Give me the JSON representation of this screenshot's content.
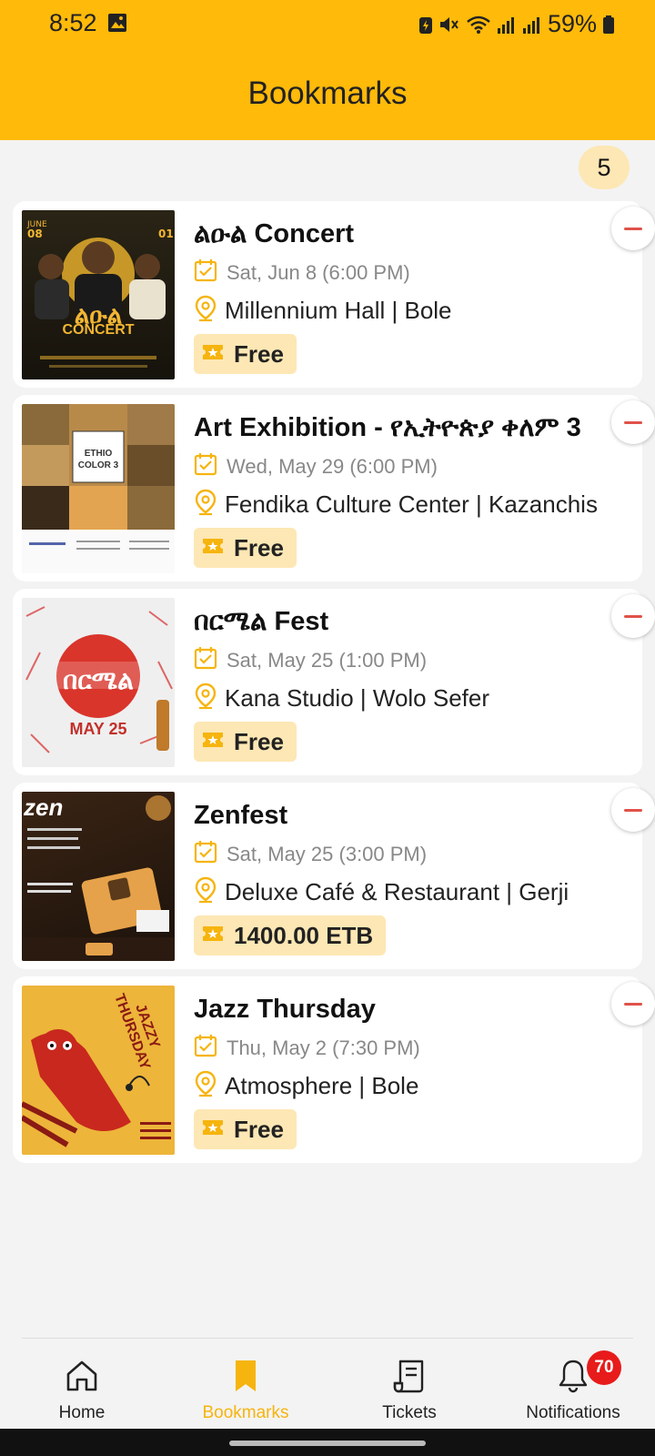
{
  "status_bar": {
    "time": "8:52",
    "battery": "59%",
    "icons": [
      "image-icon",
      "battery-saver-icon",
      "mute-icon",
      "wifi-icon",
      "signal-icon",
      "signal-icon",
      "battery-icon"
    ]
  },
  "header": {
    "title": "Bookmarks"
  },
  "bookmarks_count": "5",
  "events": [
    {
      "title": "ልዑል Concert",
      "date": "Sat, Jun 8 (6:00 PM)",
      "location": "Millennium Hall | Bole",
      "price": "Free",
      "poster_text": "CONCERT"
    },
    {
      "title": "Art Exhibition - የኢትዮጵያ ቀለም 3",
      "date": "Wed, May 29 (6:00 PM)",
      "location": "Fendika Culture Center | Kazanchis",
      "price": "Free",
      "poster_text": "ETHIO COLOR 3"
    },
    {
      "title": "በርሜል Fest",
      "date": "Sat, May 25 (1:00 PM)",
      "location": "Kana Studio | Wolo Sefer",
      "price": "Free",
      "poster_text": "MAY 25"
    },
    {
      "title": "Zenfest",
      "date": "Sat, May 25 (3:00 PM)",
      "location": "Deluxe Café & Restaurant | Gerji",
      "price": "1400.00 ETB",
      "poster_text": "zen"
    },
    {
      "title": "Jazz Thursday",
      "date": "Thu, May 2 (7:30 PM)",
      "location": "Atmosphere | Bole",
      "price": "Free",
      "poster_text": "JAZZY THURSDAY"
    }
  ],
  "bottom_nav": {
    "items": [
      {
        "label": "Home",
        "icon": "home-icon"
      },
      {
        "label": "Bookmarks",
        "icon": "bookmark-icon"
      },
      {
        "label": "Tickets",
        "icon": "ticket-icon"
      },
      {
        "label": "Notifications",
        "icon": "bell-icon"
      }
    ],
    "active": "Bookmarks",
    "notifications_badge": "70"
  },
  "colors": {
    "brand_yellow": "#FFBA0A",
    "price_tag_bg": "#FDE7B4",
    "remove_red": "#E0524A",
    "badge_red": "#E81B1B"
  }
}
